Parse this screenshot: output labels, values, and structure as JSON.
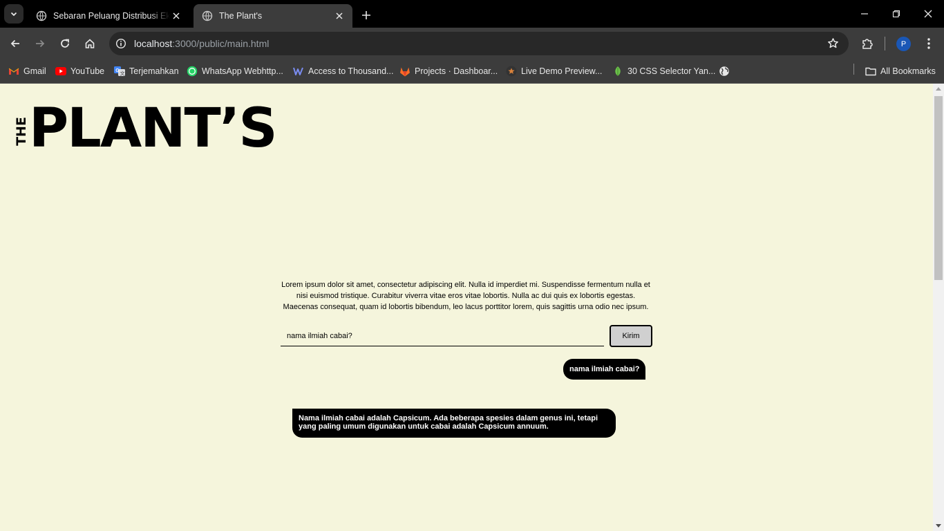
{
  "tabs": [
    {
      "title": "Sebaran Peluang Distribusi Ekspor",
      "active": false,
      "icon": "globe-icon"
    },
    {
      "title": "The Plant's",
      "active": true,
      "icon": "globe-icon"
    }
  ],
  "address_bar": {
    "host": "localhost",
    "path": ":3000/public/main.html"
  },
  "bookmarks": [
    {
      "label": "Gmail",
      "icon": "gmail-icon"
    },
    {
      "label": "YouTube",
      "icon": "youtube-icon"
    },
    {
      "label": "Terjemahkan",
      "icon": "translate-icon"
    },
    {
      "label": "WhatsApp Webhttp...",
      "icon": "whatsapp-icon"
    },
    {
      "label": "Access to Thousand...",
      "icon": "w-logo-icon"
    },
    {
      "label": "Projects · Dashboar...",
      "icon": "gitlab-icon"
    },
    {
      "label": "Live Demo Preview...",
      "icon": "star-badge-icon"
    },
    {
      "label": "30 CSS Selector Yan...",
      "icon": "leaf-icon"
    },
    {
      "label": "",
      "icon": "globe-icon"
    }
  ],
  "all_bookmarks_label": "All Bookmarks",
  "profile_initial": "P",
  "page": {
    "logo_small": "THE",
    "logo_big": "PLANT’S",
    "intro": "Lorem ipsum dolor sit amet, consectetur adipiscing elit. Nulla id imperdiet mi. Suspendisse fermentum nulla et nisi euismod tristique. Curabitur viverra vitae eros vitae lobortis. Nulla ac dui quis ex lobortis egestas. Maecenas consequat, quam id lobortis bibendum, leo lacus porttitor lorem, quis sagittis urna odio nec ipsum.",
    "input_value": "nama ilmiah cabai?",
    "send_label": "Kirim",
    "user_message": "nama ilmiah cabai?",
    "bot_message": "Nama ilmiah cabai adalah Capsicum. Ada beberapa spesies dalam genus ini, tetapi yang paling umum digunakan untuk cabai adalah Capsicum annuum."
  },
  "colors": {
    "page_background": "#f5f5dc",
    "chrome_dark": "#000000",
    "chrome_toolbar": "#3c3c3c",
    "bubble": "#000000",
    "button": "#d0d0d0"
  }
}
